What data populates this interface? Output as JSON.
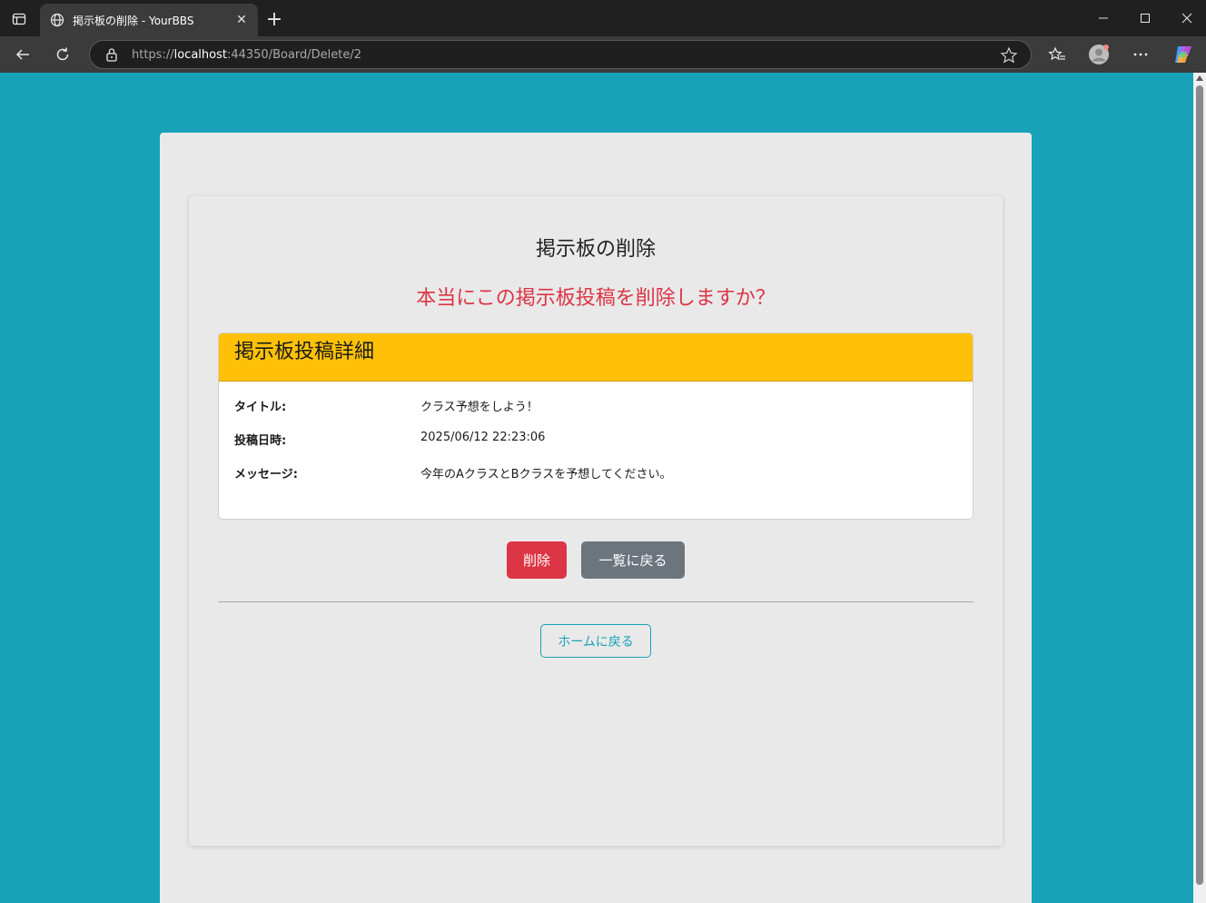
{
  "browser": {
    "tab_title": "掲示板の削除 - YourBBS",
    "url_prefix": "https://",
    "url_host": "localhost",
    "url_rest": ":44350/Board/Delete/2"
  },
  "page": {
    "title": "掲示板の削除",
    "confirm_text": "本当にこの掲示板投稿を削除しますか？",
    "detail": {
      "header": "掲示板投稿詳細",
      "rows": [
        {
          "label": "タイトル:",
          "value": "クラス予想をしよう！"
        },
        {
          "label": "投稿日時:",
          "value": "2025/06/12 22:23:06"
        },
        {
          "label": "メッセージ:",
          "value": "今年のAクラスとBクラスを予想してください。"
        }
      ]
    },
    "delete_label": "削除",
    "back_label": "一覧に戻る",
    "home_label": "ホームに戻る"
  },
  "colors": {
    "page_bg": "#17a2b8",
    "danger": "#dc3545",
    "warning": "#ffc107",
    "secondary": "#6c757d",
    "info": "#17a2b8"
  }
}
